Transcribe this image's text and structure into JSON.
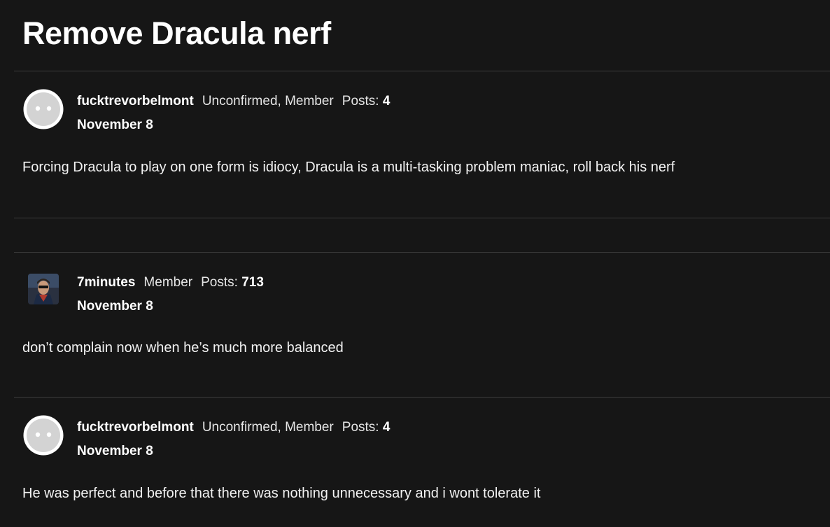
{
  "discussion": {
    "title": "Remove Dracula nerf"
  },
  "posts": [
    {
      "author": "fucktrevorbelmont",
      "roles": "Unconfirmed, Member",
      "posts_label": "Posts:",
      "posts_count": "4",
      "date": "November 8",
      "body": "Forcing Dracula to play on one form is idiocy, Dracula is a multi-tasking problem maniac, roll back his nerf",
      "avatar": "default-avatar-icon"
    },
    {
      "author": "7minutes",
      "roles": "Member",
      "posts_label": "Posts:",
      "posts_count": "713",
      "date": "November 8",
      "body": "don’t complain now when he’s much more balanced",
      "avatar": "user-photo-avatar"
    },
    {
      "author": "fucktrevorbelmont",
      "roles": "Unconfirmed, Member",
      "posts_label": "Posts:",
      "posts_count": "4",
      "date": "November 8",
      "body": "He was perfect and before that there was nothing unnecessary and i wont tolerate it",
      "avatar": "default-avatar-icon"
    }
  ],
  "colors": {
    "background": "#161616",
    "divider": "#3b3b3b",
    "text": "#ffffff"
  }
}
